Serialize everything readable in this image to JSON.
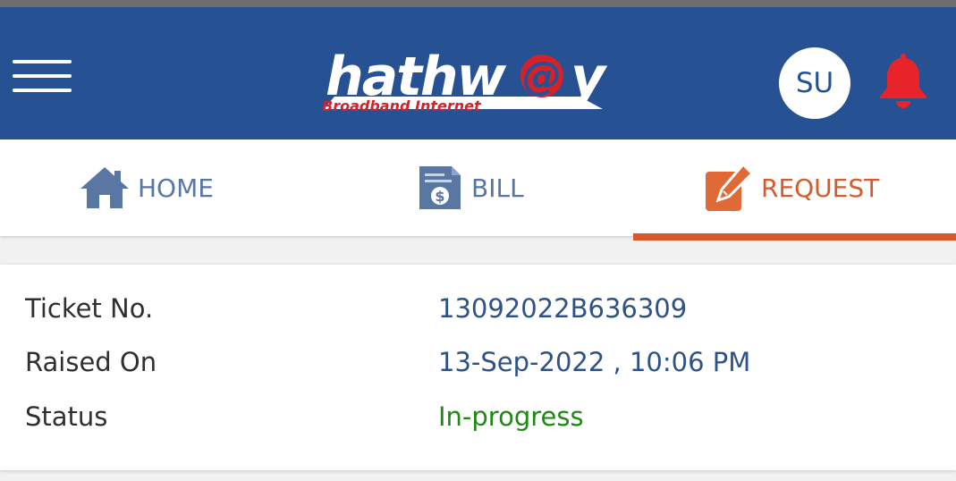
{
  "header": {
    "logo_text": "hathw@y",
    "logo_subtext": "Broadband Internet",
    "avatar_initials": "SU",
    "colors": {
      "bar": "#265193",
      "bell": "#e8242a",
      "logo_red": "#d3222a"
    },
    "icons": {
      "menu": "hamburger-menu-icon",
      "bell": "bell-icon"
    }
  },
  "tabs": [
    {
      "label": "HOME",
      "icon": "home-icon",
      "active": false
    },
    {
      "label": "BILL",
      "icon": "bill-icon",
      "active": false
    },
    {
      "label": "REQUEST",
      "icon": "edit-request-icon",
      "active": true
    }
  ],
  "accent": "#d65a2b",
  "ticket": {
    "ticket_no_label": "Ticket No.",
    "ticket_no": "13092022B636309",
    "raised_on_label": "Raised On",
    "raised_on": "13-Sep-2022 , 10:06 PM",
    "status_label": "Status",
    "status": "In-progress",
    "status_color": "#1e8a14"
  }
}
